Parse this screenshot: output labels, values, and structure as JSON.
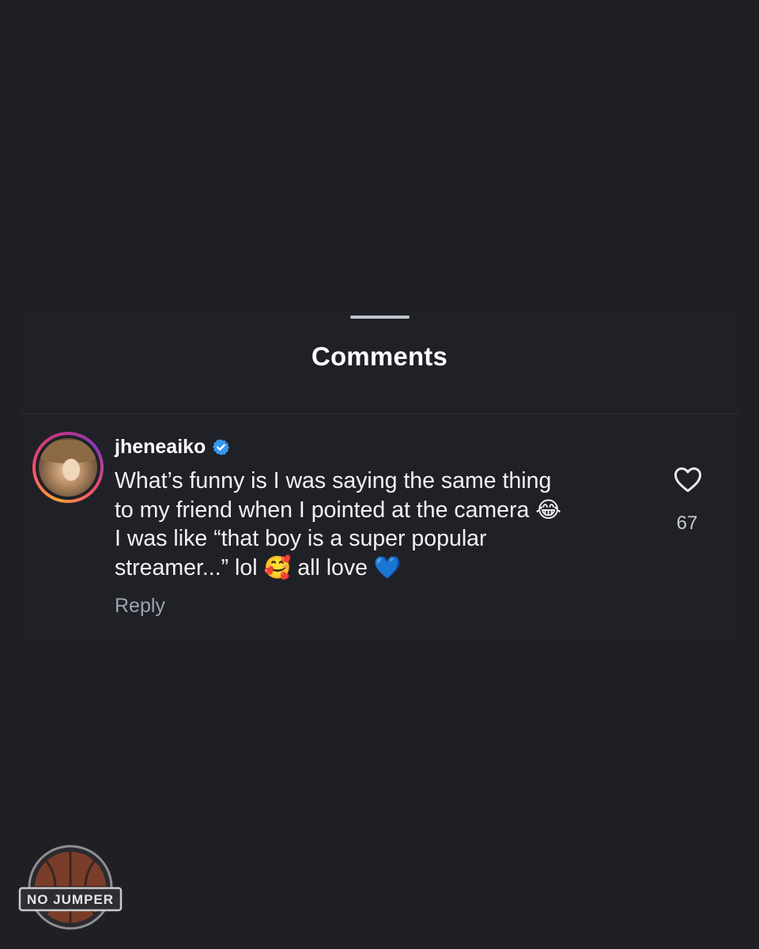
{
  "sheet": {
    "title": "Comments"
  },
  "comment": {
    "username": "jheneaiko",
    "verified_icon": "verified-badge-icon",
    "lines": [
      "What’s funny is I was saying the same thing",
      "to my friend when I pointed at the camera",
      "I was like “that boy is a super popular",
      "streamer...” lol",
      "all love"
    ],
    "emojis": {
      "laughing": "😂",
      "smiling_hearts": "🥰",
      "blue_heart": "💙"
    },
    "reply_label": "Reply",
    "like_icon": "heart-outline-icon",
    "like_count": "67"
  },
  "watermark": {
    "text": "NO JUMPER"
  },
  "colors": {
    "background": "#1f1f24",
    "verified_blue": "#3797f0",
    "muted_text": "#9ea3ad"
  }
}
